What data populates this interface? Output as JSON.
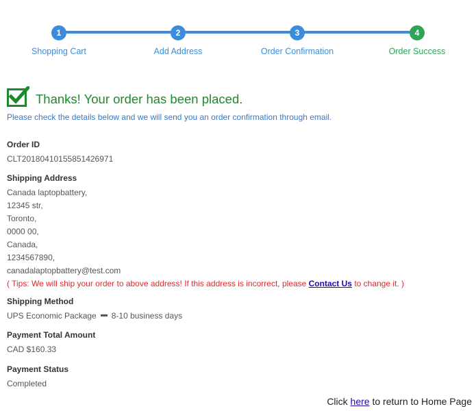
{
  "steps": [
    {
      "number": "1",
      "label": "Shopping Cart"
    },
    {
      "number": "2",
      "label": "Add Address"
    },
    {
      "number": "3",
      "label": "Order Confirmation"
    },
    {
      "number": "4",
      "label": "Order Success"
    }
  ],
  "colors": {
    "step_active": "#3b8ddb",
    "step_done": "#2ea457",
    "success": "#1c8a2a",
    "tips": "#e0282c"
  },
  "success": {
    "title": "Thanks! Your order has been placed.",
    "notice": "Please check the details below and we will send you an order confirmation through email."
  },
  "order": {
    "id_label": "Order ID",
    "id_value": "CLT20180410155851426971",
    "address_label": "Shipping Address",
    "address_lines": [
      "Canada laptopbattery,",
      "12345 str,",
      "Toronto,",
      "0000 00,",
      "Canada,",
      "1234567890,",
      "canadalaptopbattery@test.com"
    ],
    "tips_prefix": "( Tips: We will ship your order to above address! If this address is incorrect, please ",
    "tips_link": "Contact Us",
    "tips_suffix": " to change it. )",
    "method_label": "Shipping Method",
    "method_name": "UPS Economic Package",
    "method_time": "8-10 business days",
    "total_label": "Payment Total Amount",
    "total_value": "CAD $160.33",
    "status_label": "Payment Status",
    "status_value": "Completed"
  },
  "footer": {
    "prefix": "Click ",
    "link": "here",
    "suffix": " to return to Home Page"
  }
}
